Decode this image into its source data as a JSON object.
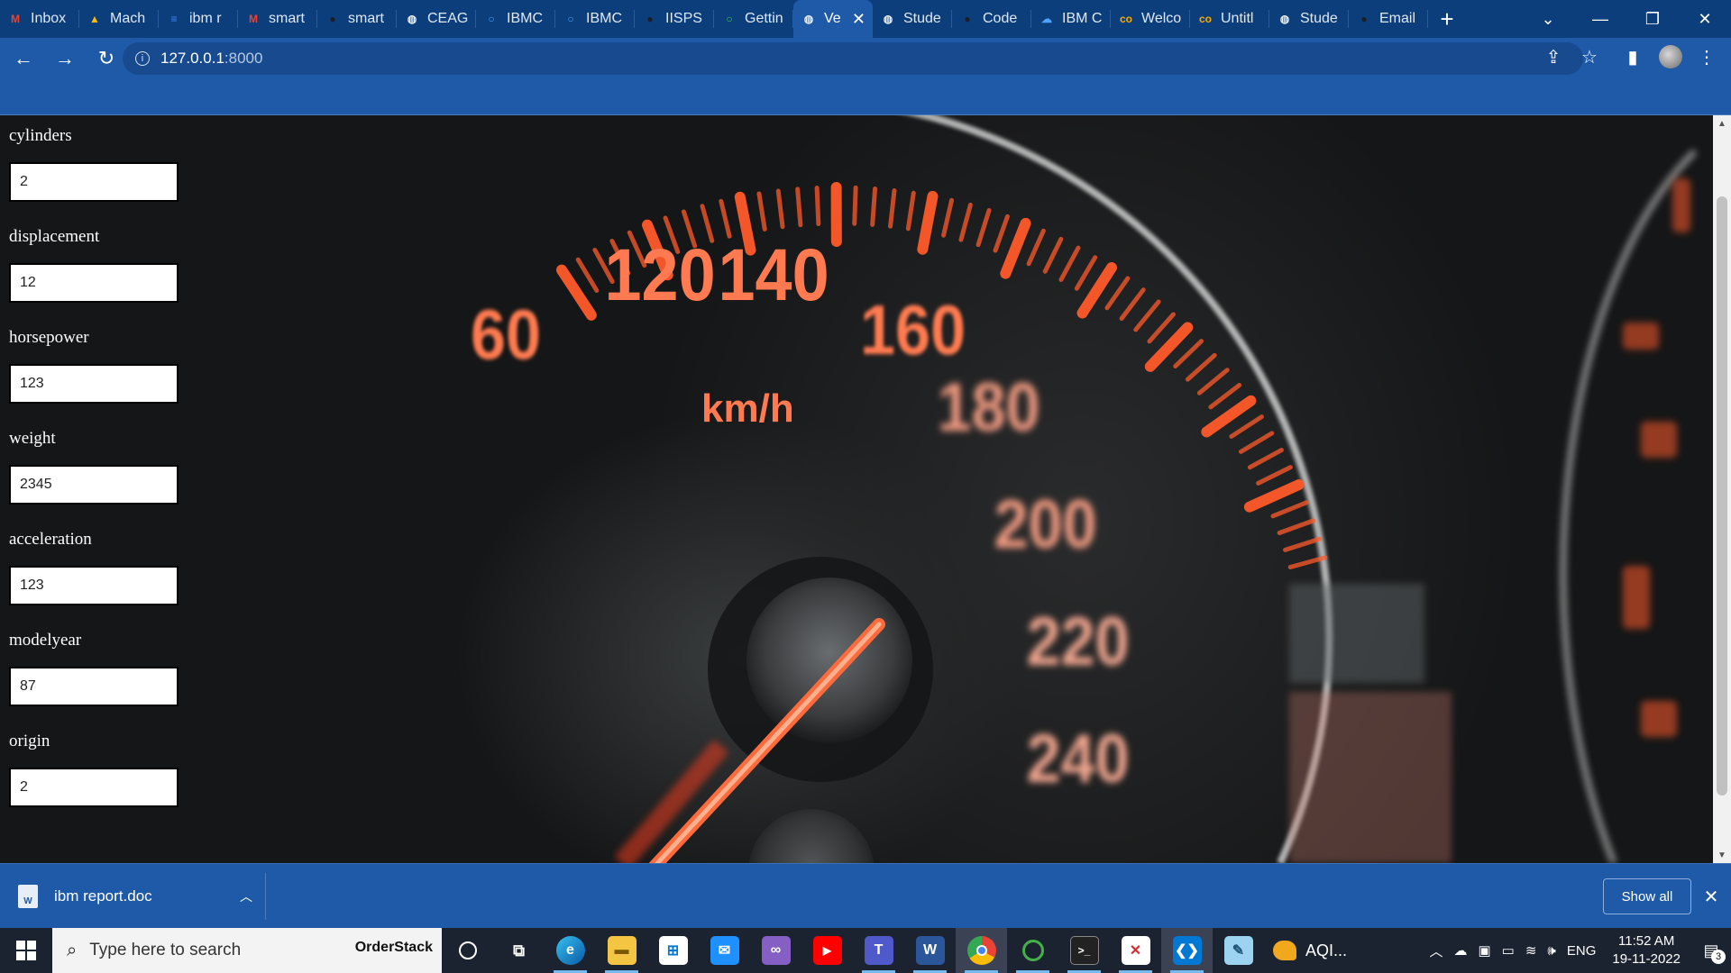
{
  "browser": {
    "tabs": [
      {
        "label": "Inbox",
        "icon": "gmail-icon",
        "fav_text": "M",
        "fav_color": "#ea4335"
      },
      {
        "label": "Mach",
        "icon": "google-drive-icon",
        "fav_text": "▲",
        "fav_color": "#fbbc04"
      },
      {
        "label": "ibm r",
        "icon": "google-docs-icon",
        "fav_text": "≡",
        "fav_color": "#4285f4"
      },
      {
        "label": "smart",
        "icon": "gmail-icon",
        "fav_text": "M",
        "fav_color": "#ea4335"
      },
      {
        "label": "smart",
        "icon": "github-icon",
        "fav_text": "●",
        "fav_color": "#1b1f24"
      },
      {
        "label": "CEAG",
        "icon": "globe-icon",
        "fav_text": "◍",
        "fav_color": "#e8eef8"
      },
      {
        "label": "IBMC",
        "icon": "ibm-cloud-icon",
        "fav_text": "○",
        "fav_color": "#4da3ff"
      },
      {
        "label": "IBMC",
        "icon": "ibm-cloud-icon",
        "fav_text": "○",
        "fav_color": "#4da3ff"
      },
      {
        "label": "IISPS",
        "icon": "github-icon",
        "fav_text": "●",
        "fav_color": "#1b1f24"
      },
      {
        "label": "Gettin",
        "icon": "loading-icon",
        "fav_text": "○",
        "fav_color": "#3ccf4e"
      },
      {
        "label": "Ve",
        "icon": "globe-icon",
        "fav_text": "◍",
        "fav_color": "#e8eef8",
        "active": true
      },
      {
        "label": "Stude",
        "icon": "globe-icon",
        "fav_text": "◍",
        "fav_color": "#e8eef8"
      },
      {
        "label": "Code",
        "icon": "github-icon",
        "fav_text": "●",
        "fav_color": "#1b1f24"
      },
      {
        "label": "IBM C",
        "icon": "ibm-cloud-icon",
        "fav_text": "☁",
        "fav_color": "#4da3ff"
      },
      {
        "label": "Welco",
        "icon": "colab-icon",
        "fav_text": "co",
        "fav_color": "#f9ab00"
      },
      {
        "label": "Untitl",
        "icon": "colab-icon",
        "fav_text": "co",
        "fav_color": "#f9ab00"
      },
      {
        "label": "Stude",
        "icon": "globe-icon",
        "fav_text": "◍",
        "fav_color": "#e8eef8"
      },
      {
        "label": "Email",
        "icon": "github-icon",
        "fav_text": "●",
        "fav_color": "#1b1f24"
      }
    ],
    "url_host": "127.0.0.1",
    "url_port": ":8000"
  },
  "form": {
    "fields": [
      {
        "label": "cylinders",
        "value": "2"
      },
      {
        "label": "displacement",
        "value": "12"
      },
      {
        "label": "horsepower",
        "value": "123"
      },
      {
        "label": "weight",
        "value": "2345"
      },
      {
        "label": "acceleration",
        "value": "123"
      },
      {
        "label": "modelyear",
        "value": "87"
      },
      {
        "label": "origin",
        "value": "2"
      }
    ]
  },
  "background": {
    "speedometer_labels": [
      "60",
      "120",
      "140",
      "160",
      "180",
      "200",
      "220",
      "240"
    ],
    "unit": "km/h"
  },
  "download": {
    "filename": "ibm report.doc",
    "show_all_label": "Show all"
  },
  "taskbar": {
    "search_placeholder": "Type here to search",
    "search_brand": "OrderStack",
    "weather_label": "AQI...",
    "language": "ENG",
    "time": "11:52 AM",
    "date": "19-11-2022",
    "notification_count": "3"
  },
  "colors": {
    "tab_strip": "#0c3e7c",
    "toolbar": "#1f5aa8",
    "speedo_orange": "#ff5a2a",
    "taskbar": "#1c2330"
  }
}
